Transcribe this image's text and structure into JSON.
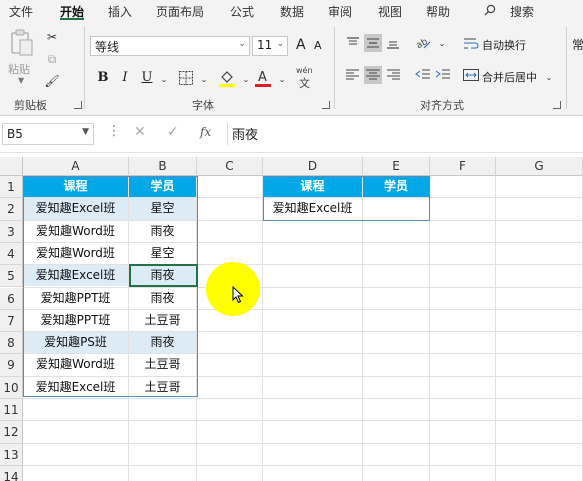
{
  "menu": {
    "tabs": [
      "文件",
      "开始",
      "插入",
      "页面布局",
      "公式",
      "数据",
      "审阅",
      "视图",
      "帮助"
    ],
    "active": "开始",
    "search_label": "搜索"
  },
  "ribbon": {
    "clipboard": {
      "paste_label": "粘贴",
      "group_label": "剪贴板"
    },
    "font": {
      "font_name": "等线",
      "font_size": "11",
      "group_label": "字体",
      "bold": "B",
      "italic": "I",
      "underline": "U",
      "grow": "A",
      "shrink": "A",
      "pinyin": "wén"
    },
    "alignment": {
      "wrap_text_label": "自动换行",
      "merge_label": "合并后居中",
      "group_label": "对齐方式"
    },
    "overflow_glyph": "常"
  },
  "formula_bar": {
    "name_box": "B5",
    "fx": "fx",
    "content": "雨夜"
  },
  "grid": {
    "columns": [
      "A",
      "B",
      "C",
      "D",
      "E",
      "F",
      "G"
    ],
    "rows": [
      "1",
      "2",
      "3",
      "4",
      "5",
      "6",
      "7",
      "8",
      "9",
      "10",
      "11",
      "12",
      "13",
      "14"
    ],
    "table1": {
      "headers": [
        "课程",
        "学员"
      ],
      "rows": [
        [
          "爱知趣Excel班",
          "星空"
        ],
        [
          "爱知趣Word班",
          "雨夜"
        ],
        [
          "爱知趣Word班",
          "星空"
        ],
        [
          "爱知趣Excel班",
          "雨夜"
        ],
        [
          "爱知趣PPT班",
          "雨夜"
        ],
        [
          "爱知趣PPT班",
          "土豆哥"
        ],
        [
          "爱知趣PS班",
          "雨夜"
        ],
        [
          "爱知趣Word班",
          "土豆哥"
        ],
        [
          "爱知趣Excel班",
          "土豆哥"
        ]
      ]
    },
    "table2": {
      "headers": [
        "课程",
        "学员"
      ],
      "rows": [
        [
          "爱知趣Excel班",
          ""
        ]
      ]
    }
  },
  "colors": {
    "accent": "#217346",
    "table_header": "#00a8e8",
    "band": "#ddebf7",
    "cursor_highlight": "#ffff00"
  }
}
